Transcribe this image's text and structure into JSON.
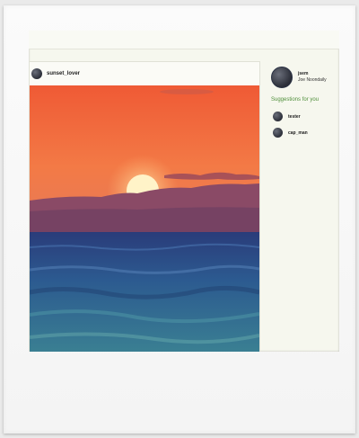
{
  "post": {
    "username": "sunset_lover",
    "image": "sunset-over-ocean"
  },
  "sidebar": {
    "current_user": {
      "username": "jsem",
      "display_name": "Joe Noondaily"
    },
    "suggestions_title": "Suggestions for you",
    "suggestions": [
      {
        "username": "tester"
      },
      {
        "username": "cap_man"
      }
    ]
  },
  "colors": {
    "accent": "#4f8f3a",
    "sky_top": "#f0633a",
    "sun": "#fff3c8",
    "sea": "#2a4a8a"
  }
}
